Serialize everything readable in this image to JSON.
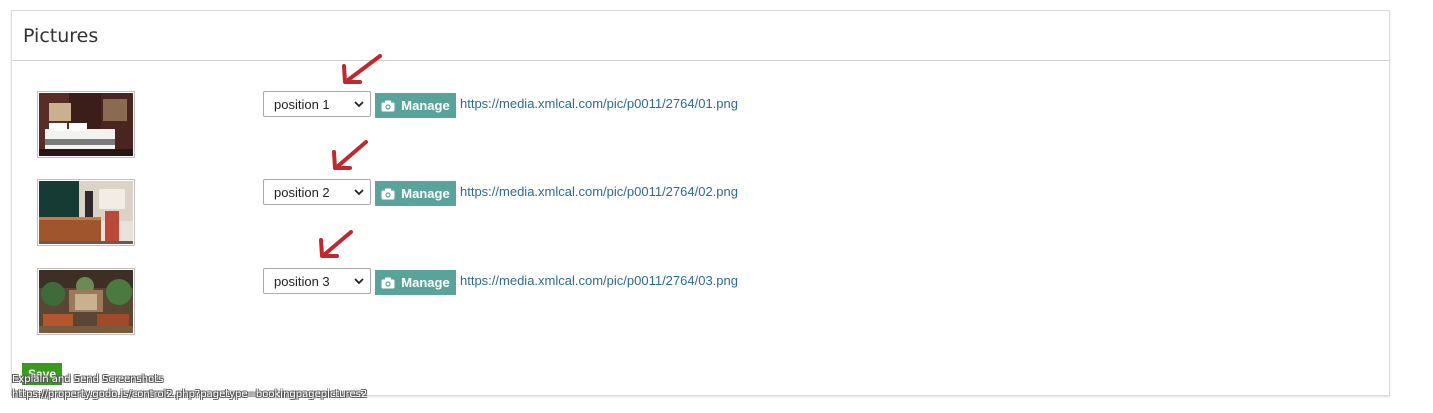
{
  "panel": {
    "title": "Pictures"
  },
  "pictures": [
    {
      "position_label": "position 1",
      "manage_label": "Manage",
      "url": "https://media.xmlcal.com/pic/p0011/2764/01.png"
    },
    {
      "position_label": "position 2",
      "manage_label": "Manage",
      "url": "https://media.xmlcal.com/pic/p0011/2764/02.png"
    },
    {
      "position_label": "position 3",
      "manage_label": "Manage",
      "url": "https://media.xmlcal.com/pic/p0011/2764/03.png"
    }
  ],
  "save_label": "Save",
  "overlay": {
    "line1": "Explain and Send Screenshots",
    "line2": "https://property.godo.is/control2.php?pagetype=bookingpagepictures2"
  },
  "icons": {
    "camera": "camera-icon",
    "chevron": "chevron-down-icon",
    "arrow": "red-arrow-annotation"
  },
  "colors": {
    "manage_button": "#5aa39a",
    "link": "#2e6a94",
    "save_button": "#3a9a1e",
    "annotation_arrow": "#c0282d"
  }
}
